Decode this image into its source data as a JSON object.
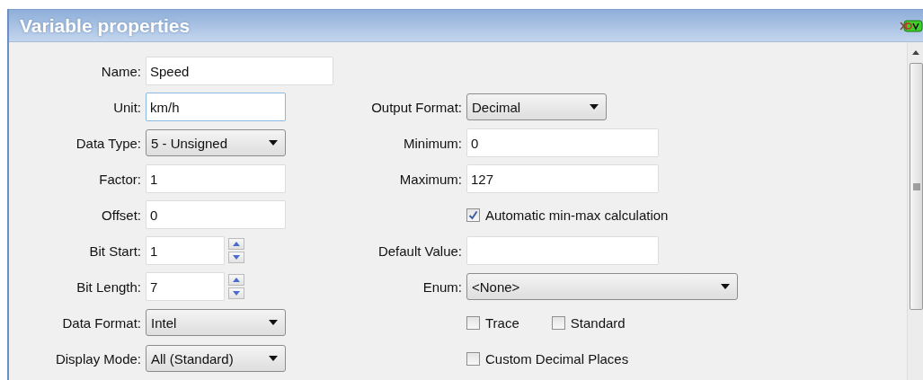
{
  "window": {
    "title": "Variable properties"
  },
  "rows": [
    {
      "left": {
        "label": "Name:",
        "kind": "text",
        "value": "Speed"
      }
    },
    {
      "left": {
        "label": "Unit:",
        "kind": "text",
        "value": "km/h",
        "focused": true
      },
      "right": {
        "label": "Output Format:",
        "kind": "dropdown",
        "value": "Decimal"
      }
    },
    {
      "left": {
        "label": "Data Type:",
        "kind": "dropdown",
        "value": "5 - Unsigned"
      },
      "right": {
        "label": "Minimum:",
        "kind": "text",
        "value": "0"
      }
    },
    {
      "left": {
        "label": "Factor:",
        "kind": "text",
        "value": "1"
      },
      "right": {
        "label": "Maximum:",
        "kind": "text",
        "value": "127"
      }
    },
    {
      "left": {
        "label": "Offset:",
        "kind": "text",
        "value": "0"
      },
      "right": {
        "kind": "checkboxes",
        "items": [
          {
            "label": "Automatic min-max calculation",
            "checked": true
          }
        ]
      }
    },
    {
      "left": {
        "label": "Bit Start:",
        "kind": "spinner",
        "value": "1"
      },
      "right": {
        "label": "Default Value:",
        "kind": "text"
      }
    },
    {
      "left": {
        "label": "Bit Length:",
        "kind": "spinner",
        "value": "7"
      },
      "right": {
        "label": "Enum:",
        "kind": "dropdown",
        "value": "<None>"
      }
    },
    {
      "left": {
        "label": "Data Format:",
        "kind": "dropdown",
        "value": "Intel"
      },
      "right": {
        "kind": "checkboxes",
        "items": [
          {
            "label": "Trace",
            "checked": false
          },
          {
            "label": "Standard",
            "checked": false
          }
        ]
      }
    },
    {
      "left": {
        "label": "Display Mode:",
        "kind": "dropdown",
        "value": "All (Standard)"
      },
      "right": {
        "kind": "checkboxes",
        "items": [
          {
            "label": "Custom Decimal Places",
            "checked": false
          }
        ]
      }
    }
  ]
}
